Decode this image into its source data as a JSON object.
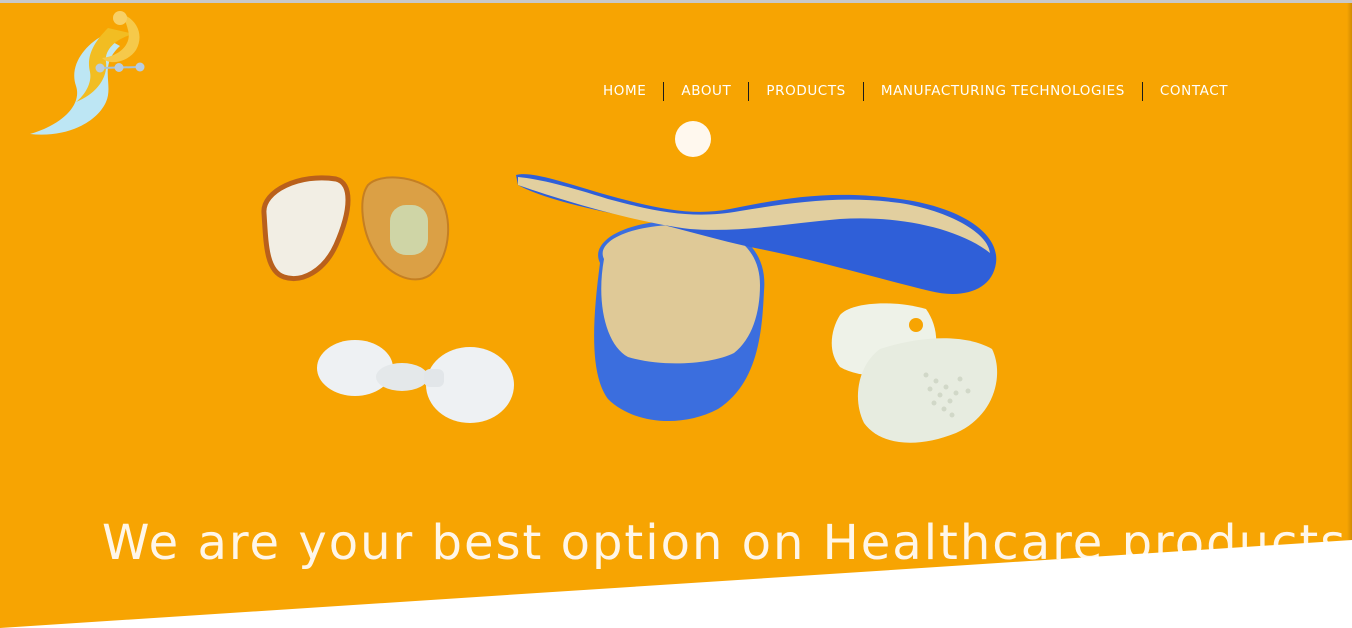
{
  "nav": {
    "items": [
      {
        "label": "HOME"
      },
      {
        "label": "ABOUT"
      },
      {
        "label": "PRODUCTS"
      },
      {
        "label": "MANUFACTURING TECHNOLOGIES"
      },
      {
        "label": "CONTACT"
      }
    ]
  },
  "hero": {
    "tagline": "We are your best option on Healthcare products",
    "background_color": "#f7a402"
  },
  "icons": {
    "logo": "brand-logo-icon",
    "scroll_dot": "circle-dot-icon"
  }
}
